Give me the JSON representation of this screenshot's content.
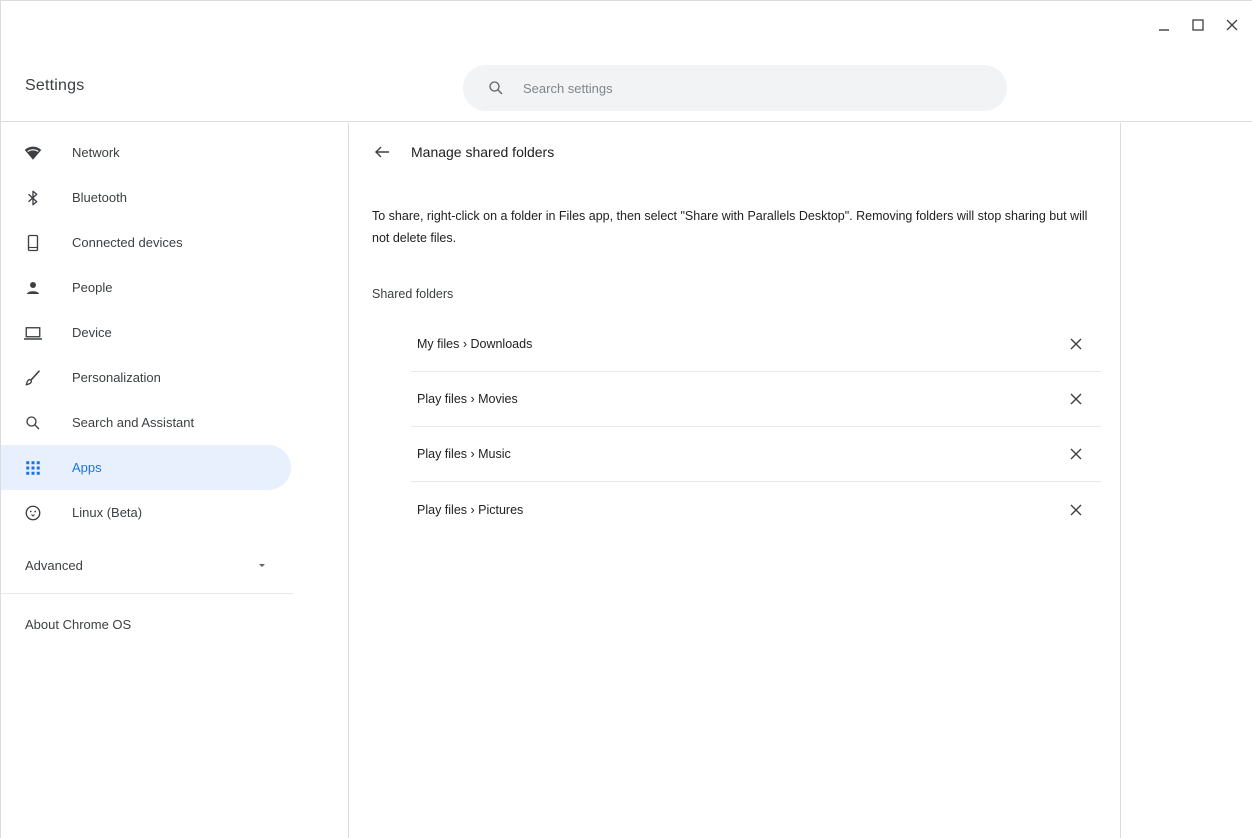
{
  "window": {
    "controls": {
      "minimize": "minimize-icon",
      "maximize": "maximize-icon",
      "close": "close-icon"
    }
  },
  "header": {
    "title": "Settings",
    "search": {
      "placeholder": "Search settings",
      "value": "",
      "icon": "search-icon"
    }
  },
  "sidebar": {
    "items": [
      {
        "label": "Network",
        "icon": "wifi-icon",
        "active": false
      },
      {
        "label": "Bluetooth",
        "icon": "bluetooth-icon",
        "active": false
      },
      {
        "label": "Connected devices",
        "icon": "phone-icon",
        "active": false
      },
      {
        "label": "People",
        "icon": "person-icon",
        "active": false
      },
      {
        "label": "Device",
        "icon": "laptop-icon",
        "active": false
      },
      {
        "label": "Personalization",
        "icon": "brush-icon",
        "active": false
      },
      {
        "label": "Search and Assistant",
        "icon": "search-icon",
        "active": false
      },
      {
        "label": "Apps",
        "icon": "apps-grid-icon",
        "active": true
      },
      {
        "label": "Linux (Beta)",
        "icon": "linux-icon",
        "active": false
      }
    ],
    "advanced_label": "Advanced",
    "about_label": "About Chrome OS"
  },
  "main": {
    "title": "Manage shared folders",
    "description": "To share, right-click on a folder in Files app, then select \"Share with Parallels Desktop\". Removing folders will stop sharing but will not delete files.",
    "section_title": "Shared folders",
    "folders": [
      {
        "name": "My files › Downloads"
      },
      {
        "name": "Play files › Movies"
      },
      {
        "name": "Play files › Music"
      },
      {
        "name": "Play files › Pictures"
      }
    ]
  },
  "colors": {
    "accent": "#1a73e8",
    "active_bg": "#e8f0fe",
    "icon": "#3c4043",
    "divider": "#dadce0"
  }
}
